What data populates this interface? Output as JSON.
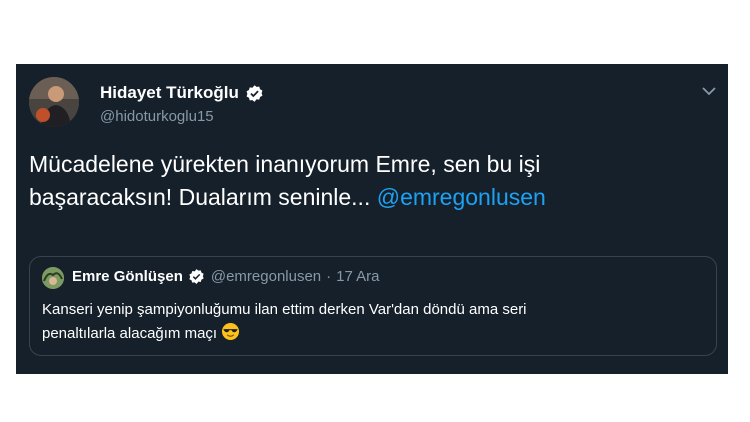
{
  "tweet": {
    "author": {
      "name": "Hidayet Türkoğlu",
      "handle": "@hidoturkoglu15",
      "verified": true
    },
    "text_line1": "Mücadelene yürekten inanıyorum Emre, sen bu işi",
    "text_line2": "başaracaksın! Dualarım seninle... ",
    "mention": "@emregonlusen",
    "menu_icon": "chevron-down-icon",
    "colors": {
      "background": "#15202b",
      "text": "#ffffff",
      "secondary": "#8899a6",
      "link": "#1da1f2",
      "border": "#38444d"
    }
  },
  "quoted_tweet": {
    "author": {
      "name": "Emre Gönlüşen",
      "handle": "@emregonlusen",
      "verified": true
    },
    "separator": "·",
    "date": "17 Ara",
    "text_line1": "Kanseri yenip şampiyonluğumu ilan ettim derken Var'dan döndü ama seri",
    "text_line2": "penaltılarla alacağım maçı",
    "emoji": "smiling-face-with-sunglasses-icon"
  }
}
